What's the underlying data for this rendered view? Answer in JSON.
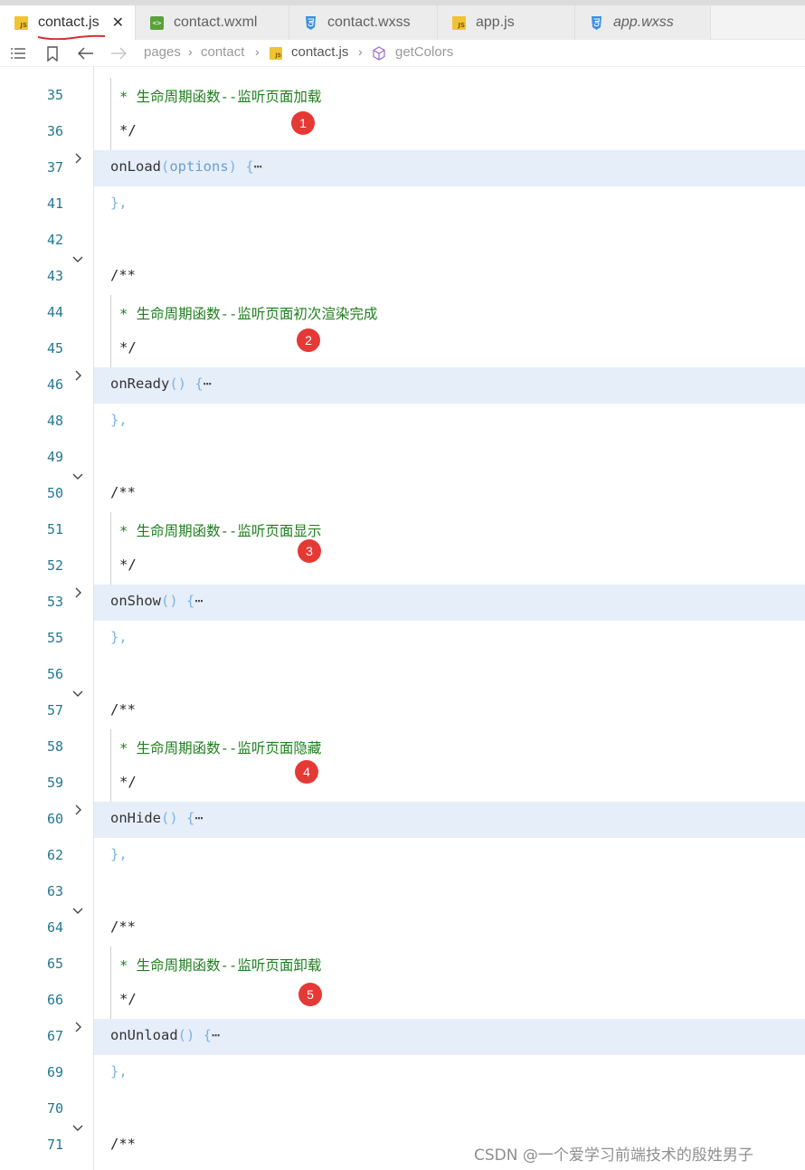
{
  "tabs": [
    {
      "label": "contact.js",
      "icon": "js-file-icon",
      "active": true
    },
    {
      "label": "contact.wxml",
      "icon": "wxml-file-icon",
      "active": false
    },
    {
      "label": "contact.wxss",
      "icon": "css-file-icon",
      "active": false
    },
    {
      "label": "app.js",
      "icon": "js-file-icon",
      "active": false
    },
    {
      "label": "app.wxss",
      "icon": "css-file-icon",
      "active": false
    }
  ],
  "breadcrumb": {
    "items": [
      "pages",
      "contact",
      "contact.js",
      "getColors"
    ]
  },
  "code_lines": [
    {
      "num": "35",
      "text": "* 生命周期函数--监听页面加载"
    },
    {
      "num": "36",
      "text": "*/"
    },
    {
      "num": "37",
      "fn": "onLoad",
      "param": "options"
    },
    {
      "num": "41",
      "text": "},"
    },
    {
      "num": "42",
      "text": ""
    },
    {
      "num": "43",
      "text": "/**"
    },
    {
      "num": "44",
      "text": "* 生命周期函数--监听页面初次渲染完成"
    },
    {
      "num": "45",
      "text": "*/"
    },
    {
      "num": "46",
      "fn": "onReady",
      "param": ""
    },
    {
      "num": "48",
      "text": "},"
    },
    {
      "num": "49",
      "text": ""
    },
    {
      "num": "50",
      "text": "/**"
    },
    {
      "num": "51",
      "text": "* 生命周期函数--监听页面显示"
    },
    {
      "num": "52",
      "text": "*/"
    },
    {
      "num": "53",
      "fn": "onShow",
      "param": ""
    },
    {
      "num": "55",
      "text": "},"
    },
    {
      "num": "56",
      "text": ""
    },
    {
      "num": "57",
      "text": "/**"
    },
    {
      "num": "58",
      "text": "* 生命周期函数--监听页面隐藏"
    },
    {
      "num": "59",
      "text": "*/"
    },
    {
      "num": "60",
      "fn": "onHide",
      "param": ""
    },
    {
      "num": "62",
      "text": "},"
    },
    {
      "num": "63",
      "text": ""
    },
    {
      "num": "64",
      "text": "/**"
    },
    {
      "num": "65",
      "text": "* 生命周期函数--监听页面卸载"
    },
    {
      "num": "66",
      "text": "*/"
    },
    {
      "num": "67",
      "fn": "onUnload",
      "param": ""
    },
    {
      "num": "69",
      "text": "},"
    },
    {
      "num": "70",
      "text": ""
    },
    {
      "num": "71",
      "text": "/**"
    }
  ],
  "markers": [
    "1",
    "2",
    "3",
    "4",
    "5"
  ],
  "watermark": "CSDN @一个爱学习前端技术的殷姓男子",
  "colors": {
    "highlight_bg": "#e5eef9",
    "comment": "#1e7e1e",
    "line_number": "#237893",
    "marker": "#e53935",
    "underline": "#d32f2f"
  }
}
